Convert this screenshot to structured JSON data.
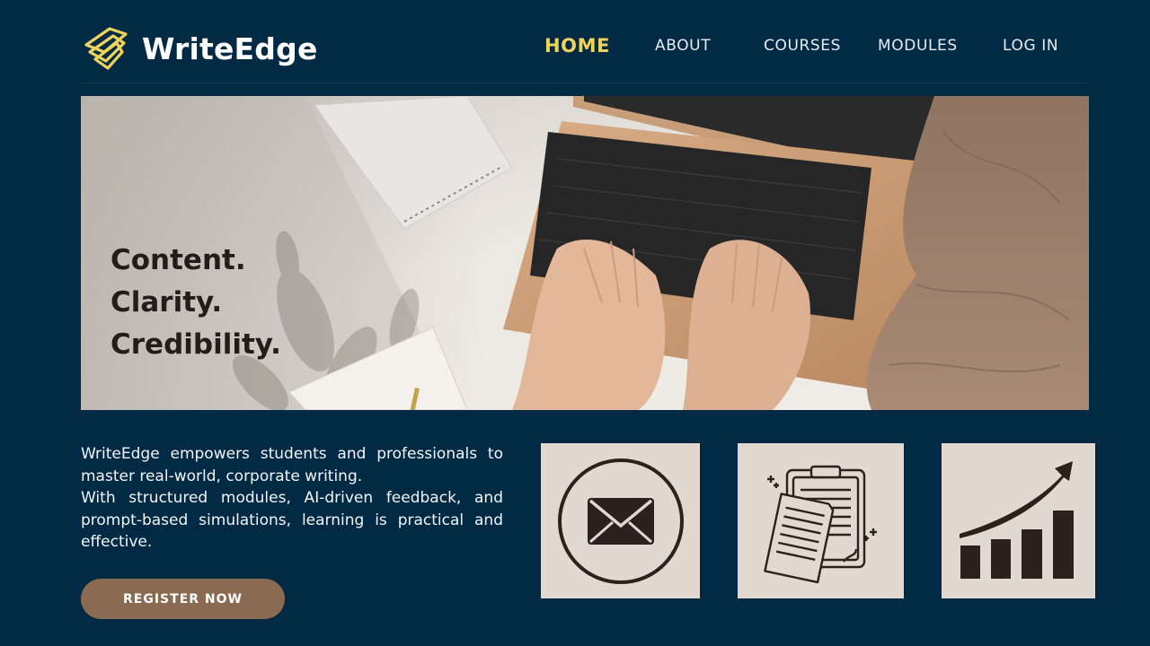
{
  "brand": {
    "name": "WriteEdge",
    "logo_icon": "stacked-chevron-logo-icon"
  },
  "nav": {
    "items": [
      {
        "label": "HOME",
        "active": true
      },
      {
        "label": "ABOUT",
        "active": false
      },
      {
        "label": "COURSES",
        "active": false
      },
      {
        "label": "MODULES",
        "active": false
      },
      {
        "label": "LOG IN",
        "active": false
      }
    ]
  },
  "hero": {
    "tagline": [
      "Content.",
      "Clarity.",
      "Credibility."
    ],
    "image": "laptop-typing-hands-photo"
  },
  "intro": {
    "line1": "WriteEdge empowers students and professionals to master real-world, corporate writing.",
    "line2": "With structured modules, AI-driven feedback, and prompt-based simulations, learning is practical and effective."
  },
  "cta": {
    "register_label": "REGISTER NOW"
  },
  "features": [
    {
      "icon": "envelope-icon"
    },
    {
      "icon": "clipboard-documents-icon"
    },
    {
      "icon": "growth-chart-icon"
    }
  ],
  "colors": {
    "background": "#022a44",
    "nav_active": "#f0d35a",
    "nav_text": "#e8edf2",
    "cta": "#8b6a52",
    "card": "#e1d9d0",
    "icon": "#2b211d"
  }
}
